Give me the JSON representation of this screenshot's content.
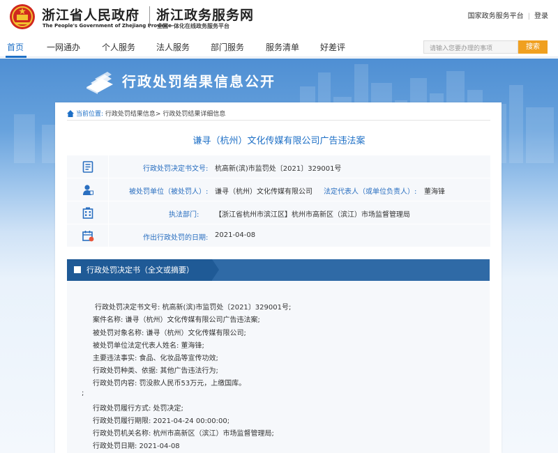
{
  "header": {
    "gov_name_cn": "浙江省人民政府",
    "gov_name_en": "The People's Government of Zhejiang Province",
    "service_name": "浙江政务服务网",
    "service_subtitle": "全国一体化在线政务服务平台",
    "top_links": [
      "国家政务服务平台",
      "登录"
    ]
  },
  "nav": {
    "items": [
      "首页",
      "一网通办",
      "个人服务",
      "法人服务",
      "部门服务",
      "服务清单",
      "好差评"
    ],
    "active": "首页",
    "search_placeholder": "请输入您要办理的事项",
    "search_button": "搜索"
  },
  "banner": {
    "title": "行政处罚结果信息公开"
  },
  "breadcrumb": {
    "current_label": "当前位置:",
    "path": "行政处罚结果信息> 行政处罚结果详细信息"
  },
  "case": {
    "title": "谦寻（杭州）文化传媒有限公司广告违法案",
    "rows": [
      {
        "icon": "document-icon",
        "label": "行政处罚决定书文号:",
        "value": "杭高新(滨)市监罚处〔2021〕329001号"
      },
      {
        "icon": "person-icon",
        "label": "被处罚单位（被处罚人）:",
        "value": "谦寻（杭州）文化传媒有限公司",
        "label2": "法定代表人（或单位负责人）:",
        "value2": "董海锋"
      },
      {
        "icon": "building-icon",
        "label": "执法部门:",
        "value": "【浙江省杭州市滨江区】杭州市高新区（滨江）市场监督管理局"
      },
      {
        "icon": "calendar-icon",
        "label": "作出行政处罚的日期:",
        "value": "2021-04-08"
      }
    ]
  },
  "decision": {
    "title": "行政处罚决定书（全文或摘要）",
    "lines": [
      "行政处罚决定书文号: 杭高新(滨)市监罚处〔2021〕329001号;",
      "案件名称: 谦寻（杭州）文化传媒有限公司广告违法案;",
      "被处罚对象名称: 谦寻（杭州）文化传媒有限公司;",
      "被处罚单位法定代表人姓名: 董海锋;",
      "主要违法事实: 食品、化妆品等宣传功效;",
      "行政处罚种类、依据: 其他广告违法行为;",
      "行政处罚内容: 罚没款人民币53万元，上缴国库。"
    ],
    "separator": ";",
    "lines2": [
      "行政处罚履行方式: 处罚决定;",
      "行政处罚履行期限: 2021-04-24 00:00:00;",
      "行政处罚机关名称: 杭州市高新区（滨江）市场监督管理局;",
      "行政处罚日期: 2021-04-08"
    ]
  },
  "colors": {
    "primary_blue": "#1d6fc6",
    "section_blue": "#1f5a96",
    "search_orange": "#f0a020",
    "emblem_red": "#d0281e"
  }
}
